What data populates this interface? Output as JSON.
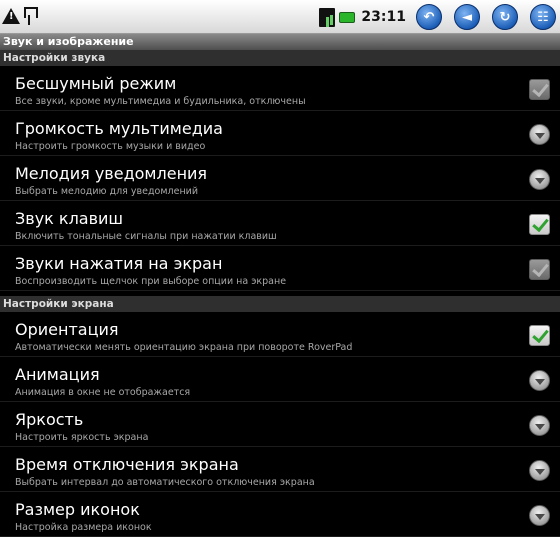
{
  "statusbar": {
    "time": "23:11",
    "left_icons": [
      "warning-icon",
      "usb-icon"
    ],
    "right_icons": [
      "sim-signal-icon",
      "battery-icon"
    ],
    "buttons": [
      "back-icon",
      "volume-icon",
      "refresh-icon",
      "keyboard-icon"
    ]
  },
  "screen": {
    "title": "Звук и изображение"
  },
  "sections": {
    "sound": "Настройки звука",
    "screen": "Настройки экрана"
  },
  "items": [
    {
      "title": "Бесшумный режим",
      "subtitle": "Все звуки, кроме мультимедиа и будильника, отключены",
      "control": "checkbox",
      "state": "disabled-checked"
    },
    {
      "title": "Громкость мультимедиа",
      "subtitle": "Настроить громкость музыки и видео",
      "control": "arrow"
    },
    {
      "title": "Мелодия уведомления",
      "subtitle": "Выбрать мелодию для уведомлений",
      "control": "arrow"
    },
    {
      "title": "Звук клавиш",
      "subtitle": "Включить тональные сигналы при нажатии клавиш",
      "control": "checkbox",
      "state": "checked"
    },
    {
      "title": "Звуки нажатия на экран",
      "subtitle": "Воспроизводить щелчок при выборе опции на экране",
      "control": "checkbox",
      "state": "disabled-checked"
    },
    {
      "title": "Ориентация",
      "subtitle": "Автоматически менять ориентацию экрана при повороте RoverPad",
      "control": "checkbox",
      "state": "checked"
    },
    {
      "title": "Анимация",
      "subtitle": "Анимация в окне не отображается",
      "control": "arrow"
    },
    {
      "title": "Яркость",
      "subtitle": "Настроить яркость экрана",
      "control": "arrow"
    },
    {
      "title": "Время отключения экрана",
      "subtitle": "Выбрать интервал до автоматического отключения экрана",
      "control": "arrow"
    },
    {
      "title": "Размер иконок",
      "subtitle": "Настройка размера иконок",
      "control": "arrow"
    }
  ],
  "colors": {
    "statusbar": "#e6e6e6",
    "accent": "#1d5fb8",
    "check": "#2fa22f"
  }
}
